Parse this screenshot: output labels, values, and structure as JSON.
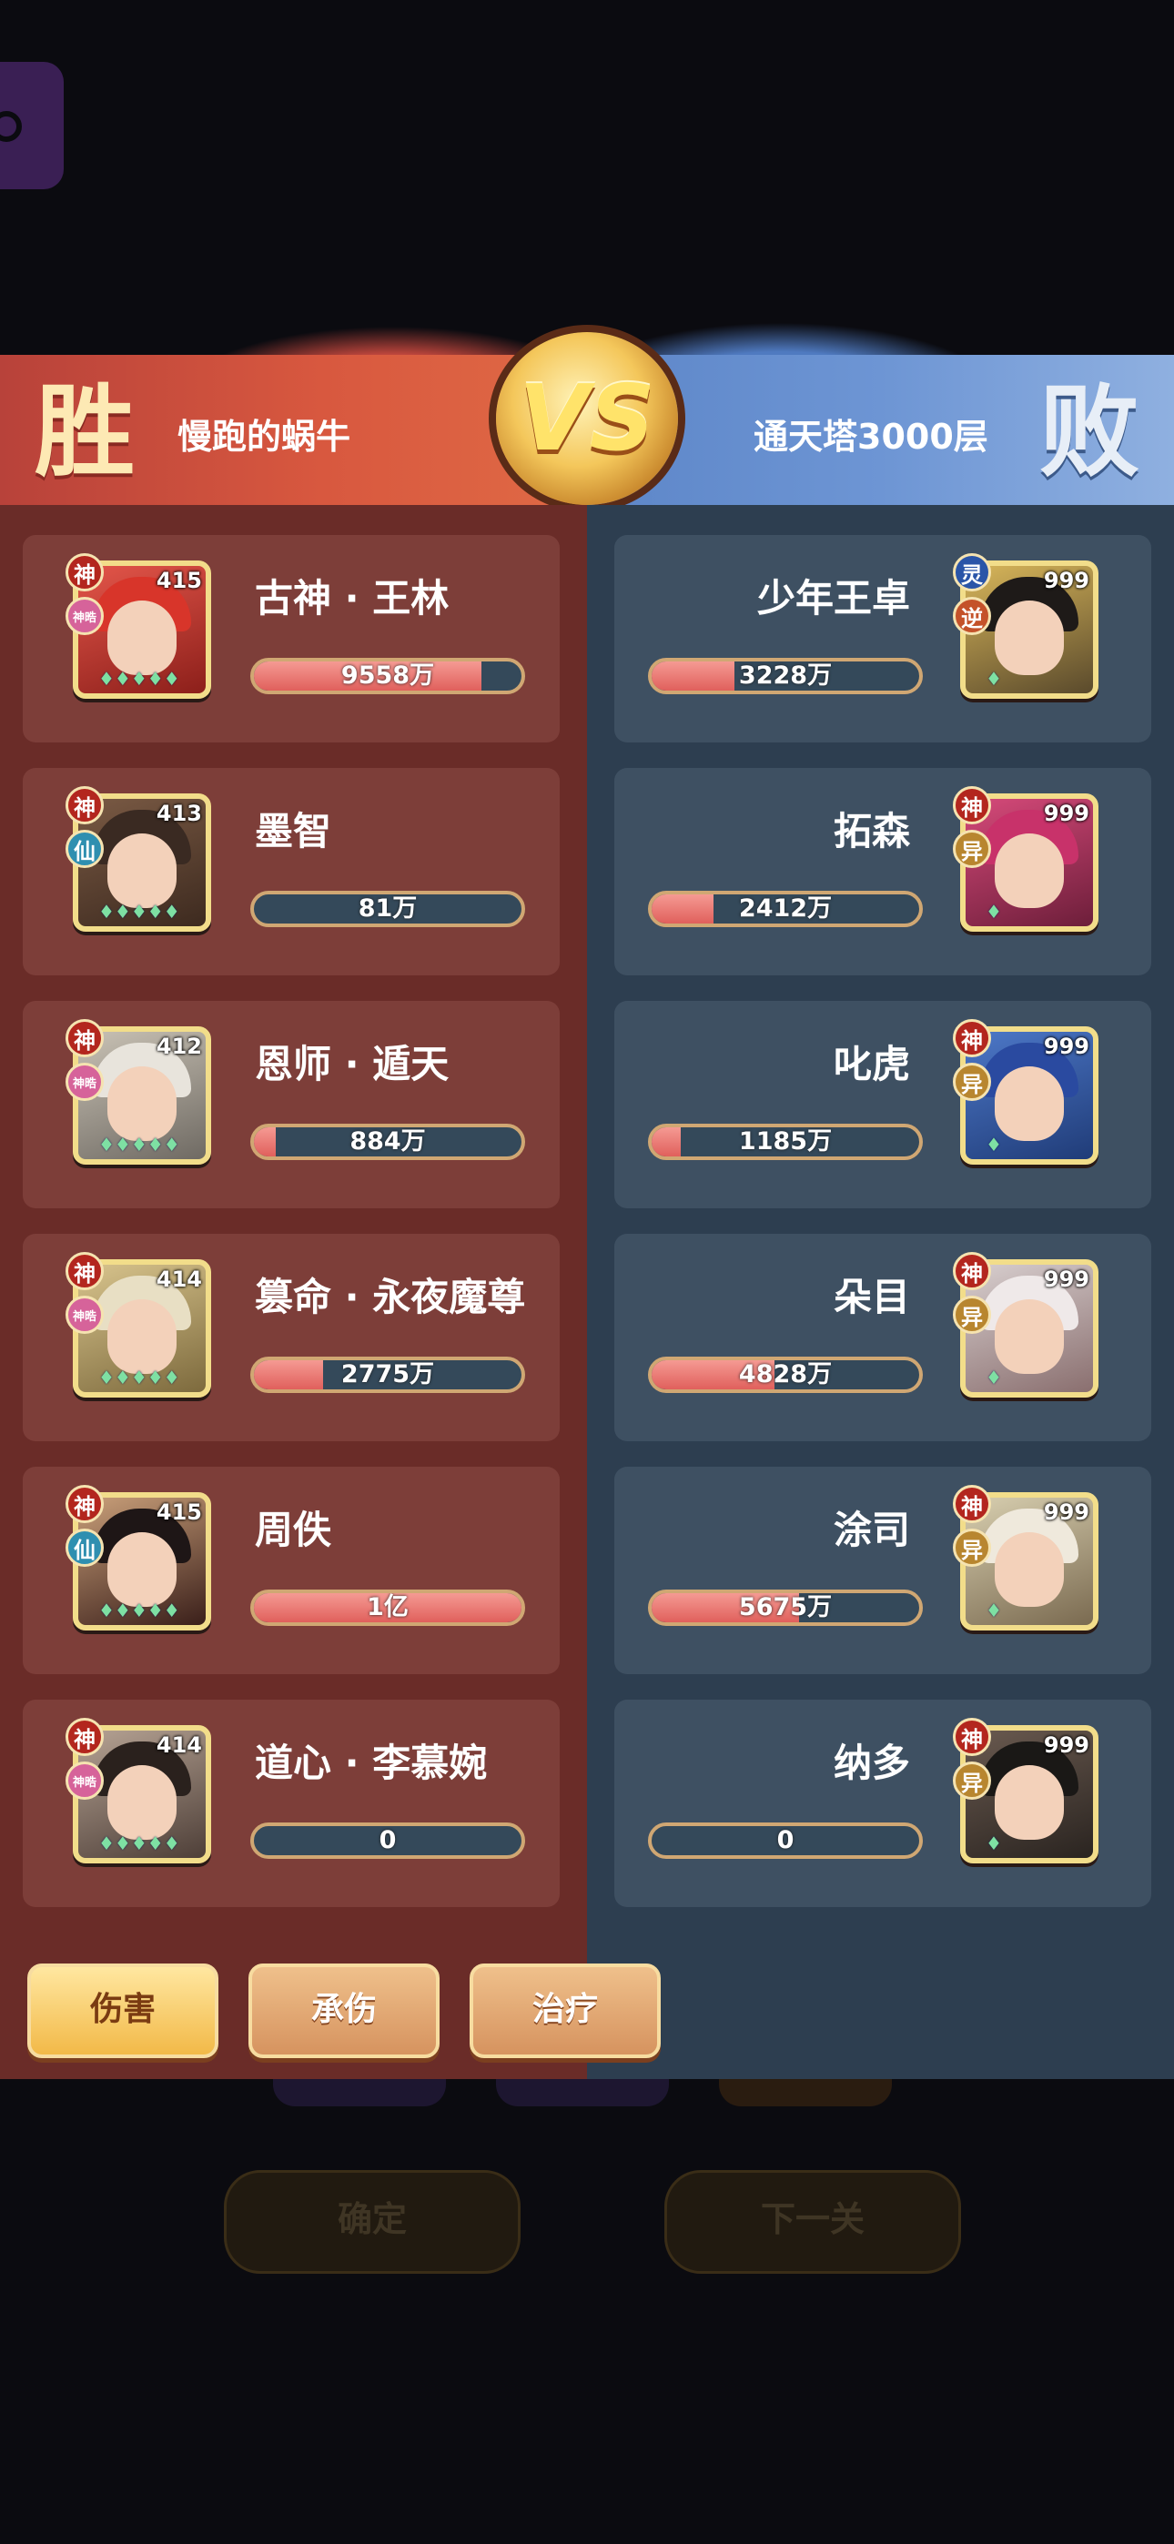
{
  "header": {
    "result_left": "胜",
    "result_right": "败",
    "player_left": "慢跑的蜗牛",
    "player_right": "通天塔3000层",
    "vs": "VS"
  },
  "left_team": [
    {
      "name": "古神 · 王林",
      "level": "415",
      "rank": "神",
      "type": "神晧",
      "damage": "9558万",
      "ratio": 0.85
    },
    {
      "name": "墨智",
      "level": "413",
      "rank": "神",
      "type": "仙",
      "damage": "81万",
      "ratio": 0.0
    },
    {
      "name": "恩师 · 遁天",
      "level": "412",
      "rank": "神",
      "type": "神晧",
      "damage": "884万",
      "ratio": 0.08
    },
    {
      "name": "篡命 · 永夜魔尊",
      "level": "414",
      "rank": "神",
      "type": "神晧",
      "damage": "2775万",
      "ratio": 0.26
    },
    {
      "name": "周佚",
      "level": "415",
      "rank": "神",
      "type": "仙",
      "damage": "1亿",
      "ratio": 1.0
    },
    {
      "name": "道心 · 李慕婉",
      "level": "414",
      "rank": "神",
      "type": "神晧",
      "damage": "0",
      "ratio": 0.0
    }
  ],
  "right_team": [
    {
      "name": "少年王卓",
      "level": "999",
      "rank": "灵",
      "type": "逆",
      "damage": "3228万",
      "ratio": 0.31
    },
    {
      "name": "拓森",
      "level": "999",
      "rank": "神",
      "type": "异",
      "damage": "2412万",
      "ratio": 0.23
    },
    {
      "name": "叱虎",
      "level": "999",
      "rank": "神",
      "type": "异",
      "damage": "1185万",
      "ratio": 0.11
    },
    {
      "name": "朵目",
      "level": "999",
      "rank": "神",
      "type": "异",
      "damage": "4828万",
      "ratio": 0.46
    },
    {
      "name": "涂司",
      "level": "999",
      "rank": "神",
      "type": "异",
      "damage": "5675万",
      "ratio": 0.55
    },
    {
      "name": "纳多",
      "level": "999",
      "rank": "神",
      "type": "异",
      "damage": "0",
      "ratio": 0.0
    }
  ],
  "tabs": [
    "伤害",
    "承伤",
    "治疗"
  ],
  "buttons": {
    "confirm": "确定",
    "next": "下一关"
  },
  "colors": {
    "win_red": "#b8423a",
    "lose_blue": "#5d86c8",
    "bar_fill": "#e0605c",
    "gold": "#f2dd8a"
  }
}
